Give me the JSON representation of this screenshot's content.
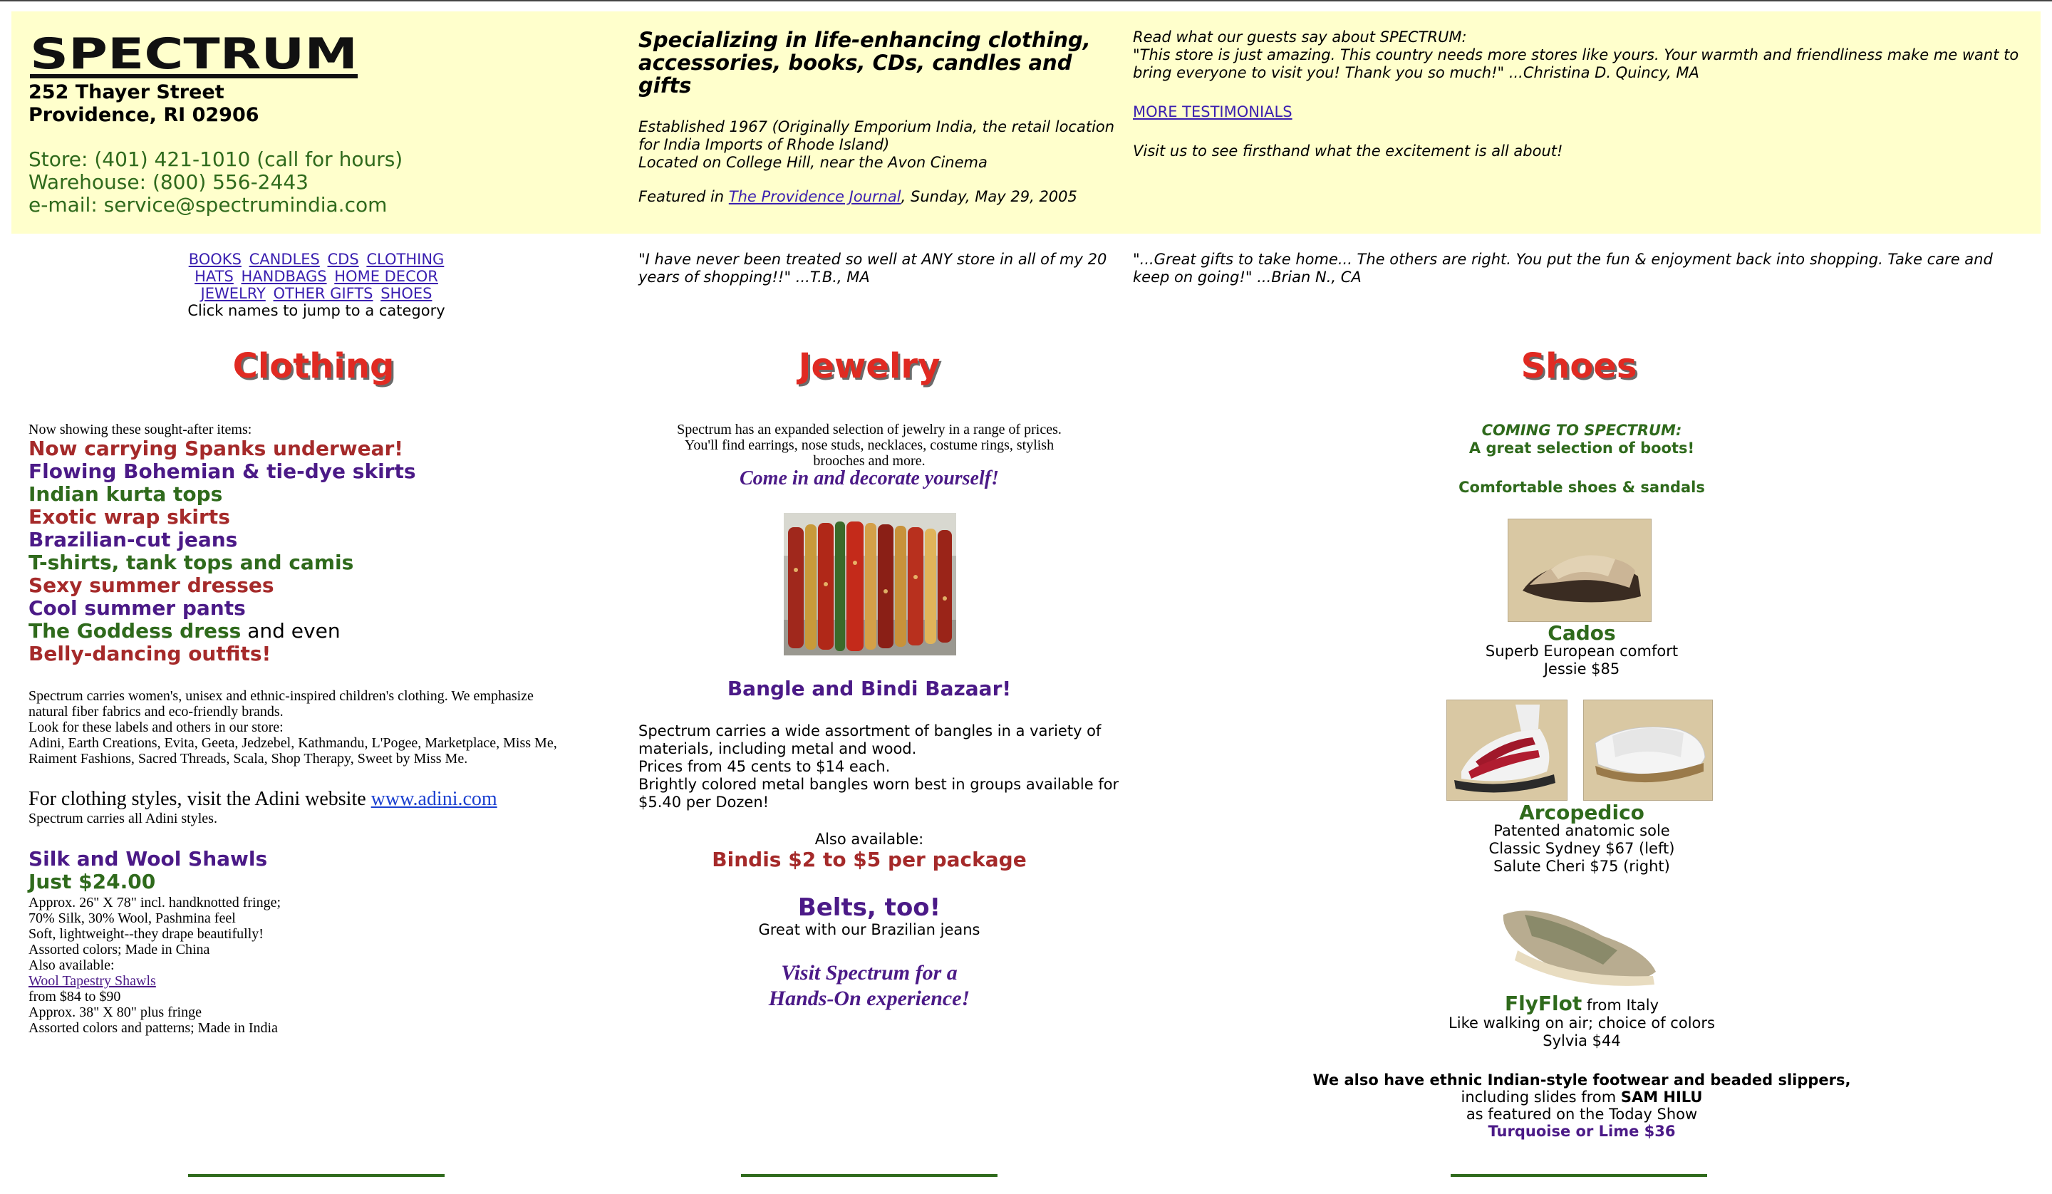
{
  "header": {
    "logo_text": "SPECTRUM",
    "address": [
      "252 Thayer Street",
      "Providence, RI 02906"
    ],
    "contact": [
      "Store: (401) 421-1010 (call for hours)",
      "Warehouse: (800) 556-2443",
      "e-mail: service@spectrumindia.com"
    ],
    "tagline": "Specializing in life-enhancing clothing, accessories, books, CDs, candles and gifts",
    "established": [
      "Established 1967 (Originally Emporium India, the retail location",
      "for India Imports of Rhode Island)",
      "Located on College Hill, near the Avon Cinema"
    ],
    "featured_prefix": "Featured in ",
    "featured_link": "The Providence Journal",
    "featured_suffix": ", Sunday, May 29, 2005",
    "testimonial_intro": "Read what our guests say about SPECTRUM:",
    "testimonial_quote": "\"This store is just amazing. This country needs more stores like yours. Your warmth and friendliness make me want to bring everyone to visit you! Thank you so much!\" ...Christina D. Quincy, MA",
    "more_testimonials": "MORE TESTIMONIALS",
    "visit_us": "Visit us to see firsthand what the excitement is all about!"
  },
  "nav": {
    "row1": [
      "BOOKS",
      "CANDLES",
      "CDS",
      "CLOTHING"
    ],
    "row2": [
      "HATS",
      "HANDBAGS",
      "HOME DECOR"
    ],
    "row3": [
      "JEWELRY",
      "OTHER GIFTS",
      "SHOES"
    ],
    "hint": "Click names to jump to a category"
  },
  "quotes": {
    "q1": "\"I have never been treated so well at ANY store in all of my 20 years of shopping!!\" ...T.B., MA",
    "q2": "\"...Great gifts to take home... The others are right. You put the fun & enjoyment back into shopping. Take care and keep on going!\" ...Brian N., CA"
  },
  "clothing": {
    "title": "Clothing",
    "intro": "Now showing these sought-after items:",
    "items": [
      {
        "text": "Now carrying Spanks underwear!",
        "color": "#a52a2a"
      },
      {
        "text": "Flowing Bohemian & tie-dye skirts",
        "color": "#4b1a87"
      },
      {
        "text": "Indian kurta tops",
        "color": "#2f6a1c"
      },
      {
        "text": "Exotic wrap skirts",
        "color": "#a52a2a"
      },
      {
        "text": "Brazilian-cut jeans",
        "color": "#4b1a87"
      },
      {
        "text": "T-shirts, tank tops and camis",
        "color": "#2f6a1c"
      },
      {
        "text": "Sexy summer dresses",
        "color": "#a52a2a"
      },
      {
        "text": "Cool summer pants",
        "color": "#4b1a87"
      },
      {
        "text": "The Goddess dress",
        "color": "#2f6a1c"
      },
      {
        "text": "Belly-dancing outfits!",
        "color": "#a52a2a"
      }
    ],
    "and_even": " and even",
    "desc": [
      "Spectrum carries women's, unisex and ethnic-inspired children's clothing. We emphasize",
      "natural fiber fabrics and eco-friendly brands.",
      "Look for these labels and others in our store:",
      "Adini, Earth Creations, Evita, Geeta, Jedzebel, Kathmandu, L'Pogee, Marketplace, Miss Me,",
      "Raiment Fashions, Sacred Threads, Scala, Shop Therapy, Sweet by Miss Me."
    ],
    "adini_prefix": "For clothing styles, visit the Adini website ",
    "adini_link": "www.adini.com",
    "adini_sub": "Spectrum carries all Adini styles.",
    "shawl_title": "Silk and Wool Shawls",
    "shawl_price": "Just $24.00",
    "shawl_desc": [
      "Approx. 26\" X 78\" incl. handknotted fringe;",
      "70% Silk, 30% Wool, Pashmina feel",
      "Soft, lightweight--they drape beautifully!",
      "Assorted colors; Made in China",
      "Also available:"
    ],
    "tapestry_link": "Wool Tapestry Shawls",
    "tapestry_desc": [
      "from $84 to $90",
      "Approx. 38\" X 80\" plus fringe",
      "Assorted colors and patterns; Made in India"
    ]
  },
  "jewelry": {
    "title": "Jewelry",
    "desc": [
      "Spectrum has an expanded selection of jewelry in a range of prices.",
      "You'll find earrings, nose studs, necklaces, costume rings, stylish",
      "brooches and more."
    ],
    "come_in": "Come in and decorate yourself!",
    "bazaar": "Bangle and Bindi Bazaar!",
    "bangle_desc": [
      "Spectrum carries a wide assortment of bangles in a variety of",
      "materials, including metal and wood.",
      "Prices from 45 cents to $14 each.",
      "Brightly colored metal bangles worn best in groups available for",
      "$5.40 per Dozen!"
    ],
    "also": "Also available:",
    "bindis": "Bindis $2 to $5 per package",
    "belts": "Belts, too!",
    "belts_sub": "Great with our Brazilian jeans",
    "visit": [
      "Visit Spectrum for a",
      "Hands-On experience!"
    ]
  },
  "shoes": {
    "title": "Shoes",
    "coming": [
      "COMING TO SPECTRUM:",
      "A great selection of boots!"
    ],
    "comfortable": "Comfortable shoes & sandals",
    "cados_name": "Cados",
    "cados_desc": [
      "Superb European comfort",
      "Jessie $85"
    ],
    "arc_name": "Arcopedico",
    "arc_desc": [
      "Patented anatomic sole",
      "Classic Sydney $67 (left)",
      "Salute Cheri $75 (right)"
    ],
    "fly_name": "FlyFlot",
    "fly_from": " from Italy",
    "fly_desc": [
      "Like walking on air; choice of colors",
      "Sylvia $44"
    ],
    "ethnic_bold": "We also have ethnic Indian-style footwear and beaded slippers,",
    "ethnic_line2_prefix": "including slides from ",
    "ethnic_brand": "SAM HILU",
    "ethnic_line3": "as featured on the Today Show",
    "ethnic_price": "Turquoise or Lime $36"
  },
  "colors": {
    "header_bg": "#ffffcc",
    "green": "#2f6a1c",
    "purple": "#4b1a87",
    "red": "#a52a2a",
    "title_red": "#e02a22"
  }
}
